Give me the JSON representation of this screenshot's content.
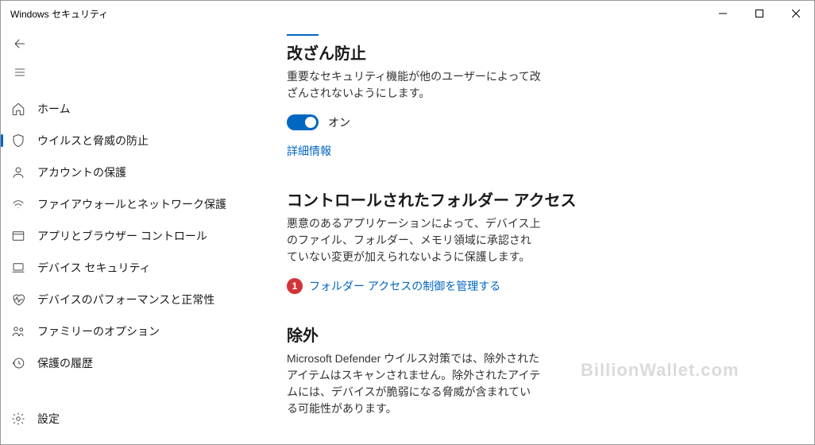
{
  "window": {
    "title": "Windows セキュリティ"
  },
  "sidebar": {
    "items": [
      {
        "label": "ホーム"
      },
      {
        "label": "ウイルスと脅威の防止"
      },
      {
        "label": "アカウントの保護"
      },
      {
        "label": "ファイアウォールとネットワーク保護"
      },
      {
        "label": "アプリとブラウザー コントロール"
      },
      {
        "label": "デバイス セキュリティ"
      },
      {
        "label": "デバイスのパフォーマンスと正常性"
      },
      {
        "label": "ファミリーのオプション"
      },
      {
        "label": "保護の履歴"
      }
    ],
    "settings": "設定"
  },
  "content": {
    "section1": {
      "title": "改ざん防止",
      "desc": "重要なセキュリティ機能が他のユーザーによって改ざんされないようにします。",
      "toggle_label": "オン",
      "link": "詳細情報"
    },
    "section2": {
      "title": "コントロールされたフォルダー アクセス",
      "desc": "悪意のあるアプリケーションによって、デバイス上のファイル、フォルダー、メモリ領域に承認されていない変更が加えられないように保護します。",
      "badge": "1",
      "link": "フォルダー アクセスの制御を管理する"
    },
    "section3": {
      "title": "除外",
      "desc": "Microsoft Defender ウイルス対策では、除外されたアイテムはスキャンされません。除外されたアイテムには、デバイスが脆弱になる脅威が含まれている可能性があります。"
    }
  },
  "watermark": "BillionWallet.com"
}
